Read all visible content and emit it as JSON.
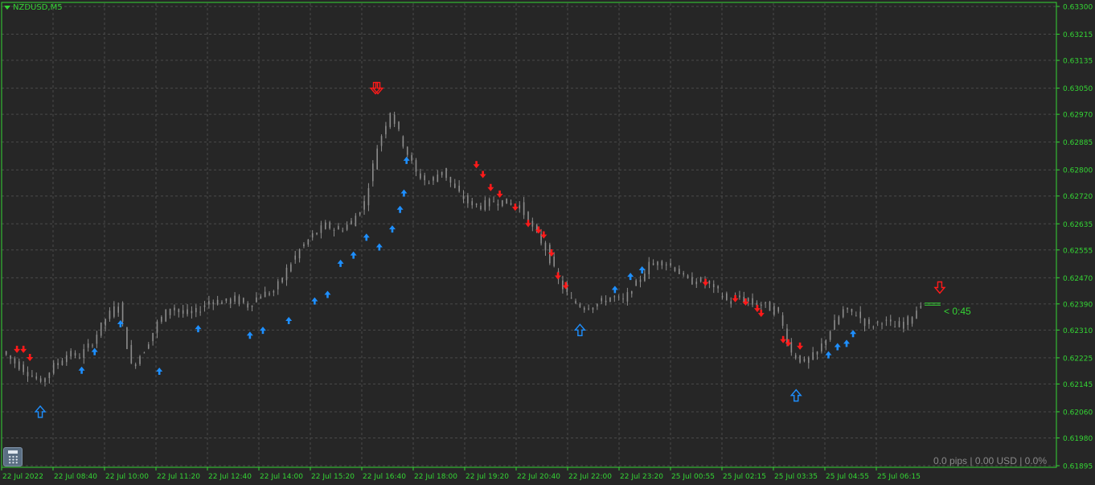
{
  "window": {
    "symbol_title": "NZDUSD,M5"
  },
  "countdown": "< 0:45",
  "status_bar": {
    "text": "0.0 pips | 0.00 USD | 0.0%"
  },
  "icons": {
    "calculator": "calculator-icon",
    "title_menu": "triangle-down-icon"
  },
  "colors": {
    "background": "#262626",
    "grid": "#4a4a4a",
    "axis": "#34d534",
    "candle": "#8c8c8c",
    "buy_signal": "#1e8fff",
    "sell_signal": "#ff1a1a",
    "bid_line": "#34d534"
  },
  "chart_data": {
    "type": "candlestick",
    "symbol": "NZDUSD",
    "timeframe": "M5",
    "y_ticks": [
      "0.63300",
      "0.63215",
      "0.63135",
      "0.63050",
      "0.62970",
      "0.62885",
      "0.62800",
      "0.62720",
      "0.62635",
      "0.62555",
      "0.62470",
      "0.62390",
      "0.62310",
      "0.62225",
      "0.62145",
      "0.62060",
      "0.61980",
      "0.61895"
    ],
    "x_ticks": [
      "22 Jul 2022",
      "22 Jul 08:40",
      "22 Jul 10:00",
      "22 Jul 11:20",
      "22 Jul 12:40",
      "22 Jul 14:00",
      "22 Jul 15:20",
      "22 Jul 16:40",
      "22 Jul 18:00",
      "22 Jul 19:20",
      "22 Jul 20:40",
      "22 Jul 22:00",
      "22 Jul 23:20",
      "25 Jul 00:55",
      "25 Jul 02:15",
      "25 Jul 03:35",
      "25 Jul 04:55",
      "25 Jul 06:15"
    ],
    "ylim": [
      0.61895,
      0.633
    ],
    "price_path": [
      [
        0,
        0.62245
      ],
      [
        1,
        0.6221
      ],
      [
        2,
        0.6218
      ],
      [
        3,
        0.6215
      ],
      [
        4,
        0.622
      ],
      [
        5,
        0.62235
      ],
      [
        6,
        0.6223
      ],
      [
        7,
        0.62275
      ],
      [
        8,
        0.62345
      ],
      [
        9,
        0.6239
      ],
      [
        10,
        0.622
      ],
      [
        11,
        0.6225
      ],
      [
        12,
        0.6233
      ],
      [
        13,
        0.6238
      ],
      [
        14,
        0.6236
      ],
      [
        15,
        0.62365
      ],
      [
        16,
        0.624
      ],
      [
        17,
        0.62395
      ],
      [
        18,
        0.62405
      ],
      [
        19,
        0.62385
      ],
      [
        20,
        0.6242
      ],
      [
        21,
        0.62425
      ],
      [
        22,
        0.62495
      ],
      [
        23,
        0.62555
      ],
      [
        24,
        0.626
      ],
      [
        25,
        0.6263
      ],
      [
        26,
        0.62615
      ],
      [
        27,
        0.6264
      ],
      [
        28,
        0.627
      ],
      [
        29,
        0.6287
      ],
      [
        30,
        0.6298
      ],
      [
        31,
        0.6288
      ],
      [
        32,
        0.6279
      ],
      [
        33,
        0.6276
      ],
      [
        34,
        0.628
      ],
      [
        35,
        0.6274
      ],
      [
        36,
        0.627
      ],
      [
        37,
        0.6269
      ],
      [
        38,
        0.62705
      ],
      [
        39,
        0.627
      ],
      [
        40,
        0.6269
      ],
      [
        41,
        0.6262
      ],
      [
        42,
        0.6256
      ],
      [
        43,
        0.6246
      ],
      [
        44,
        0.624
      ],
      [
        45,
        0.6238
      ],
      [
        46,
        0.6239
      ],
      [
        47,
        0.6241
      ],
      [
        48,
        0.624
      ],
      [
        49,
        0.6245
      ],
      [
        50,
        0.6251
      ],
      [
        51,
        0.6252
      ],
      [
        52,
        0.625
      ],
      [
        53,
        0.6246
      ],
      [
        54,
        0.6246
      ],
      [
        55,
        0.6244
      ],
      [
        56,
        0.624
      ],
      [
        57,
        0.6241
      ],
      [
        58,
        0.6239
      ],
      [
        59,
        0.62385
      ],
      [
        60,
        0.6236
      ],
      [
        61,
        0.6224
      ],
      [
        62,
        0.6221
      ],
      [
        63,
        0.6224
      ],
      [
        64,
        0.6231
      ],
      [
        65,
        0.6237
      ],
      [
        66,
        0.6236
      ],
      [
        67,
        0.6232
      ],
      [
        68,
        0.6234
      ],
      [
        69,
        0.6232
      ],
      [
        70,
        0.6234
      ],
      [
        71,
        0.6239
      ]
    ],
    "buy_arrows": [
      [
        6,
        0.62218
      ],
      [
        7,
        0.62275
      ],
      [
        9,
        0.6236
      ],
      [
        12,
        0.62215
      ],
      [
        15,
        0.62345
      ],
      [
        19,
        0.62325
      ],
      [
        20,
        0.6234
      ],
      [
        22,
        0.6237
      ],
      [
        24,
        0.6243
      ],
      [
        25,
        0.6245
      ],
      [
        26,
        0.62545
      ],
      [
        27,
        0.6257
      ],
      [
        29,
        0.62595
      ],
      [
        28,
        0.62625
      ],
      [
        30,
        0.6265
      ],
      [
        30.6,
        0.6271
      ],
      [
        30.9,
        0.6276
      ],
      [
        31.1,
        0.6286
      ],
      [
        47.2,
        0.62465
      ],
      [
        48.4,
        0.62505
      ],
      [
        49.3,
        0.62525
      ],
      [
        63.7,
        0.62265
      ],
      [
        64.4,
        0.6229
      ],
      [
        65.1,
        0.623
      ],
      [
        65.6,
        0.6233
      ]
    ],
    "sell_arrows": [
      [
        1,
        0.62225
      ],
      [
        1.5,
        0.62225
      ],
      [
        2,
        0.622
      ],
      [
        36.5,
        0.6279
      ],
      [
        37,
        0.6276
      ],
      [
        37.6,
        0.6272
      ],
      [
        38.3,
        0.627
      ],
      [
        39.5,
        0.6266
      ],
      [
        40.5,
        0.6261
      ],
      [
        41.3,
        0.6259
      ],
      [
        41.7,
        0.62575
      ],
      [
        42.3,
        0.6252
      ],
      [
        42.8,
        0.6245
      ],
      [
        43.4,
        0.6242
      ],
      [
        54.2,
        0.6243
      ],
      [
        56.5,
        0.6238
      ],
      [
        57.3,
        0.6237
      ],
      [
        58.2,
        0.6235
      ],
      [
        58.5,
        0.62335
      ],
      [
        60.2,
        0.62255
      ],
      [
        60.6,
        0.62245
      ],
      [
        61.5,
        0.62235
      ]
    ],
    "big_buy_arrows": [
      [
        2.8,
        0.6206
      ],
      [
        44.5,
        0.6231
      ],
      [
        61.2,
        0.6211
      ]
    ],
    "big_sell_arrows": [
      [
        28.7,
        0.6305
      ],
      [
        72.3,
        0.6244
      ]
    ]
  }
}
